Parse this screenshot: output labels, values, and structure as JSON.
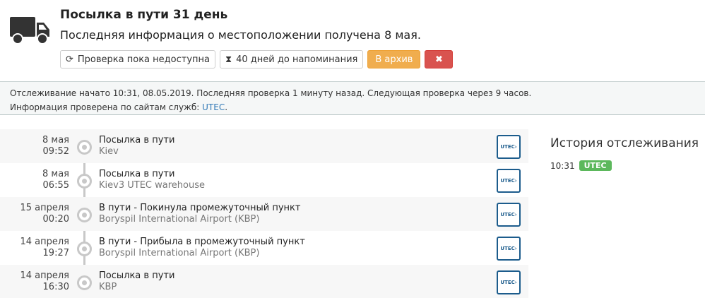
{
  "header": {
    "icon": "truck-icon",
    "title": "Посылка в пути 31 день",
    "subtitle": "Последняя информация о местоположении получена 8 мая.",
    "buttons": {
      "check": {
        "icon": "refresh-icon",
        "label": "Проверка пока недоступна"
      },
      "reminder": {
        "icon": "hourglass-icon",
        "label": "40 дней до напоминания"
      },
      "archive": {
        "label": "В архив"
      },
      "delete": {
        "icon": "close-icon",
        "label": "✖"
      }
    }
  },
  "info": {
    "line1": "Отслеживание начато 10:31, 08.05.2019. Последняя проверка 1 минуту назад. Следующая проверка через 9 часов.",
    "line2_prefix": "Информация проверена по сайтам служб: ",
    "service_link": "UTEC",
    "line2_suffix": "."
  },
  "events": [
    {
      "date": "8 мая",
      "time": "09:52",
      "status": "Посылка в пути",
      "location": "Kiev",
      "carrier_logo": "UTEC"
    },
    {
      "date": "8 мая",
      "time": "06:55",
      "status": "Посылка в пути",
      "location": "Kiev3 UTEC warehouse",
      "carrier_logo": "UTEC"
    },
    {
      "date": "15 апреля",
      "time": "00:20",
      "status": "В пути - Покинула промежуточный пункт",
      "location": "Boryspil International Airport (KBP)",
      "carrier_logo": "UTEC"
    },
    {
      "date": "14 апреля",
      "time": "19:27",
      "status": "В пути - Прибыла в промежуточный пункт",
      "location": "Boryspil International Airport (KBP)",
      "carrier_logo": "UTEC"
    },
    {
      "date": "14 апреля",
      "time": "16:30",
      "status": "Посылка в пути",
      "location": "KBP",
      "carrier_logo": "UTEC"
    }
  ],
  "history": {
    "title": "История отслеживания",
    "items": [
      {
        "time": "10:31",
        "badge": "UTEC"
      }
    ]
  },
  "colors": {
    "archive": "#f0ad4e",
    "delete": "#d9534f",
    "badge": "#5cb85c",
    "link": "#337ab7"
  }
}
